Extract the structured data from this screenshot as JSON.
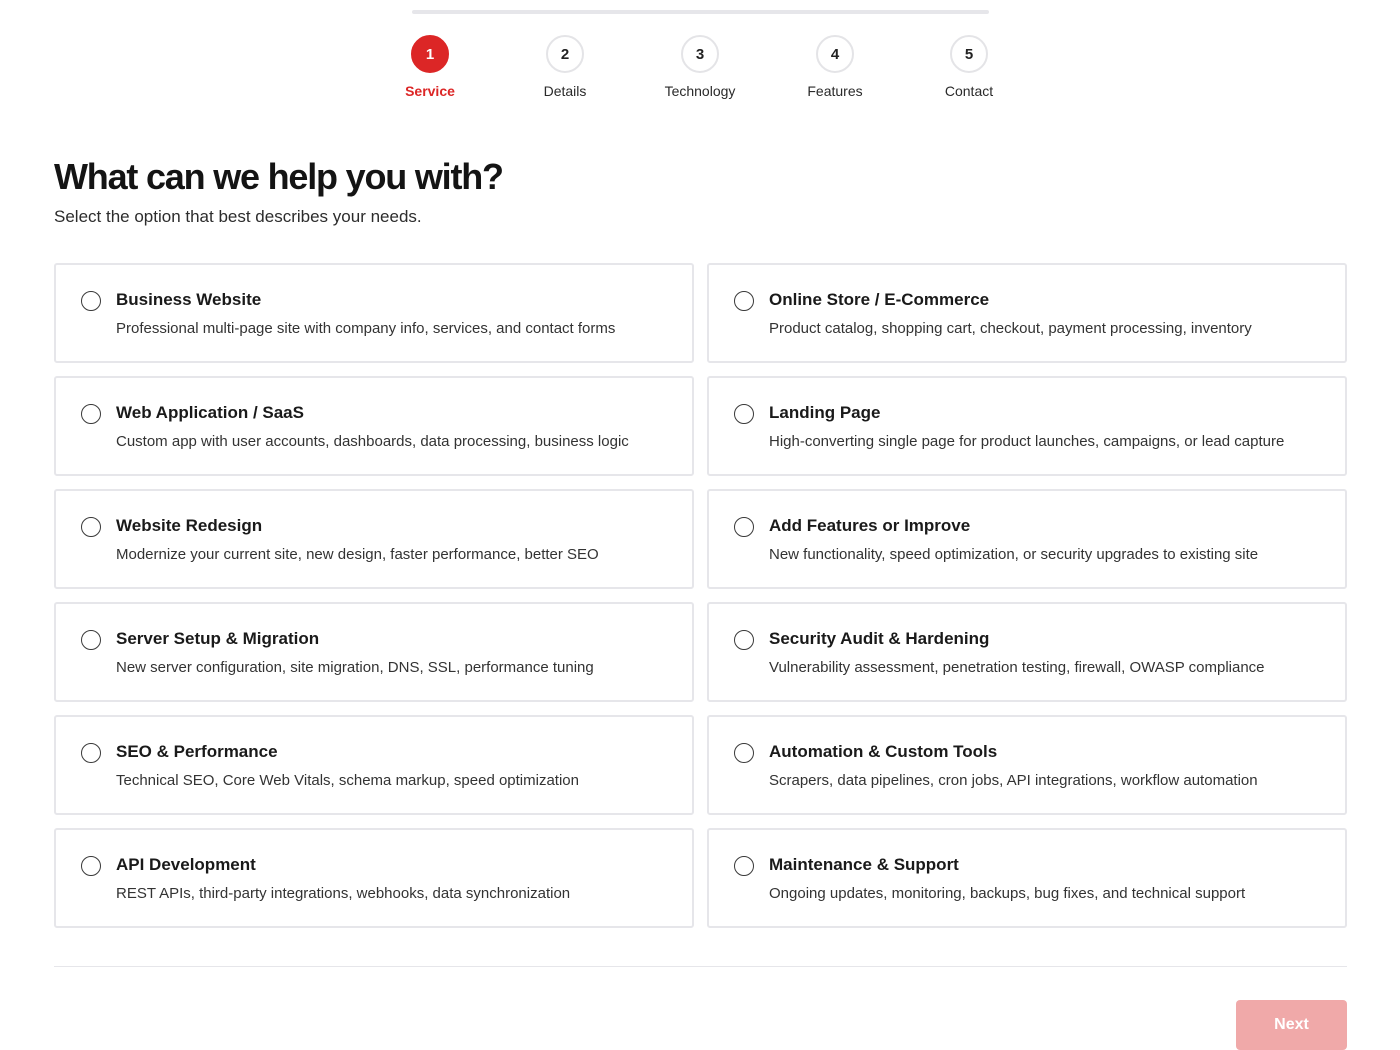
{
  "stepper": {
    "steps": [
      {
        "number": "1",
        "label": "Service",
        "active": true
      },
      {
        "number": "2",
        "label": "Details",
        "active": false
      },
      {
        "number": "3",
        "label": "Technology",
        "active": false
      },
      {
        "number": "4",
        "label": "Features",
        "active": false
      },
      {
        "number": "5",
        "label": "Contact",
        "active": false
      }
    ]
  },
  "header": {
    "title": "What can we help you with?",
    "subtitle": "Select the option that best describes your needs."
  },
  "options": [
    {
      "title": "Business Website",
      "description": "Professional multi-page site with company info, services, and contact forms",
      "selected": false
    },
    {
      "title": "Online Store / E-Commerce",
      "description": "Product catalog, shopping cart, checkout, payment processing, inventory",
      "selected": false
    },
    {
      "title": "Web Application / SaaS",
      "description": "Custom app with user accounts, dashboards, data processing, business logic",
      "selected": false
    },
    {
      "title": "Landing Page",
      "description": "High-converting single page for product launches, campaigns, or lead capture",
      "selected": false
    },
    {
      "title": "Website Redesign",
      "description": "Modernize your current site, new design, faster performance, better SEO",
      "selected": false
    },
    {
      "title": "Add Features or Improve",
      "description": "New functionality, speed optimization, or security upgrades to existing site",
      "selected": false
    },
    {
      "title": "Server Setup & Migration",
      "description": "New server configuration, site migration, DNS, SSL, performance tuning",
      "selected": false
    },
    {
      "title": "Security Audit & Hardening",
      "description": "Vulnerability assessment, penetration testing, firewall, OWASP compliance",
      "selected": false
    },
    {
      "title": "SEO & Performance",
      "description": "Technical SEO, Core Web Vitals, schema markup, speed optimization",
      "selected": false
    },
    {
      "title": "Automation & Custom Tools",
      "description": "Scrapers, data pipelines, cron jobs, API integrations, workflow automation",
      "selected": false
    },
    {
      "title": "API Development",
      "description": "REST APIs, third-party integrations, webhooks, data synchronization",
      "selected": false
    },
    {
      "title": "Maintenance & Support",
      "description": "Ongoing updates, monitoring, backups, bug fixes, and technical support",
      "selected": false
    }
  ],
  "footer": {
    "next_label": "Next",
    "next_enabled": false
  },
  "colors": {
    "accent": "#dc2626",
    "accent_disabled": "#f0a9a9",
    "border": "#e6e6ea"
  }
}
